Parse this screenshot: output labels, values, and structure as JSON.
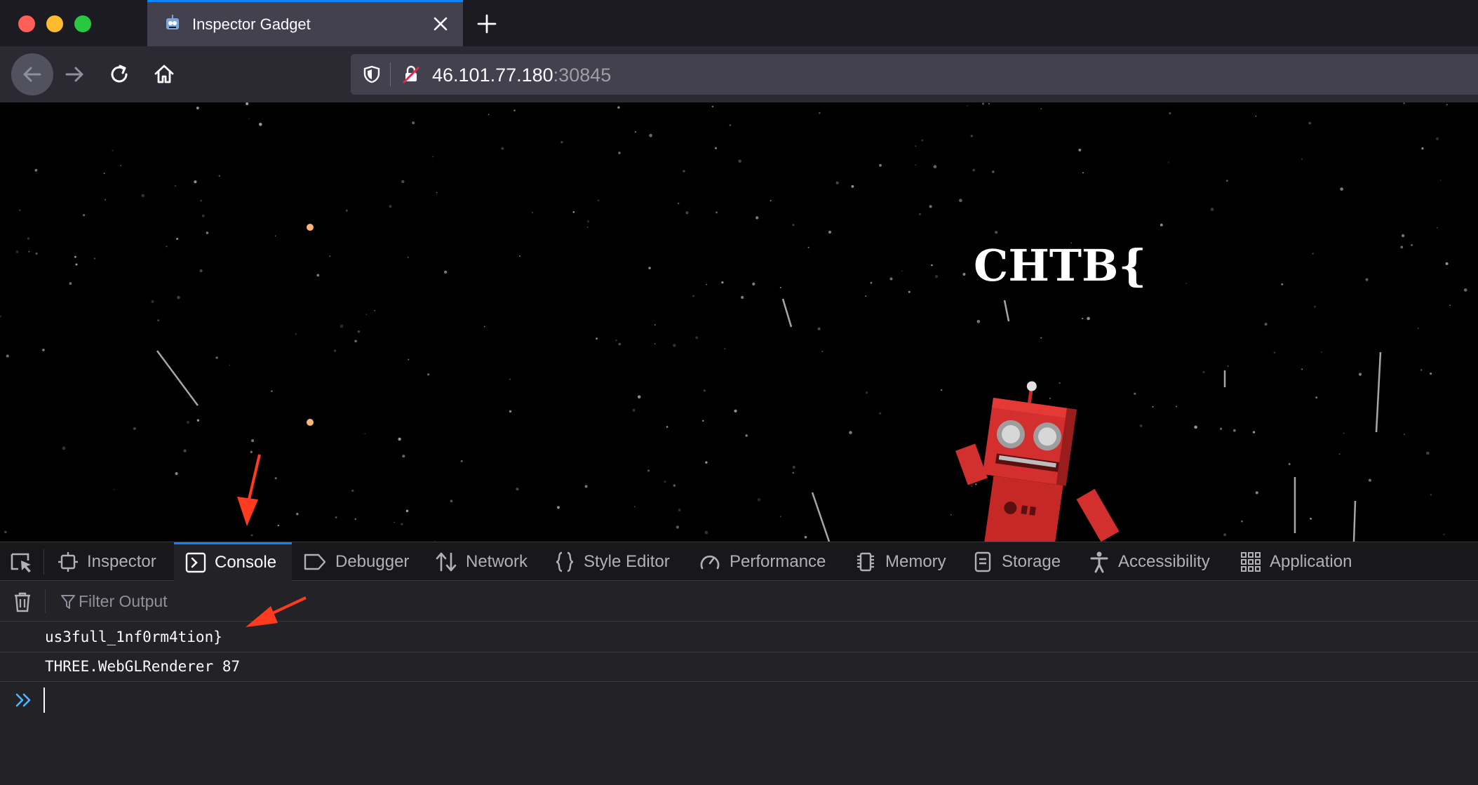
{
  "tab": {
    "title": "Inspector Gadget",
    "favicon": "robot-favicon-icon"
  },
  "nav": {
    "url_host": "46.101.77.180",
    "url_port": ":30845"
  },
  "page": {
    "flag_text": "CHTB{",
    "background": "#000000",
    "robot_color": "#d32f2f"
  },
  "devtools": {
    "tabs": [
      {
        "label": "Inspector",
        "icon": "inspector-icon"
      },
      {
        "label": "Console",
        "icon": "console-icon",
        "active": true
      },
      {
        "label": "Debugger",
        "icon": "debugger-icon"
      },
      {
        "label": "Network",
        "icon": "network-icon"
      },
      {
        "label": "Style Editor",
        "icon": "style-editor-icon"
      },
      {
        "label": "Performance",
        "icon": "performance-icon"
      },
      {
        "label": "Memory",
        "icon": "memory-icon"
      },
      {
        "label": "Storage",
        "icon": "storage-icon"
      },
      {
        "label": "Accessibility",
        "icon": "accessibility-icon"
      },
      {
        "label": "Application",
        "icon": "application-icon"
      }
    ],
    "filter_placeholder": "Filter Output",
    "logs": [
      "us3full_1nf0rm4tion}",
      "THREE.WebGLRenderer 87"
    ]
  },
  "colors": {
    "accent": "#0a84ff",
    "annotation_arrow": "#ff3b1f"
  }
}
